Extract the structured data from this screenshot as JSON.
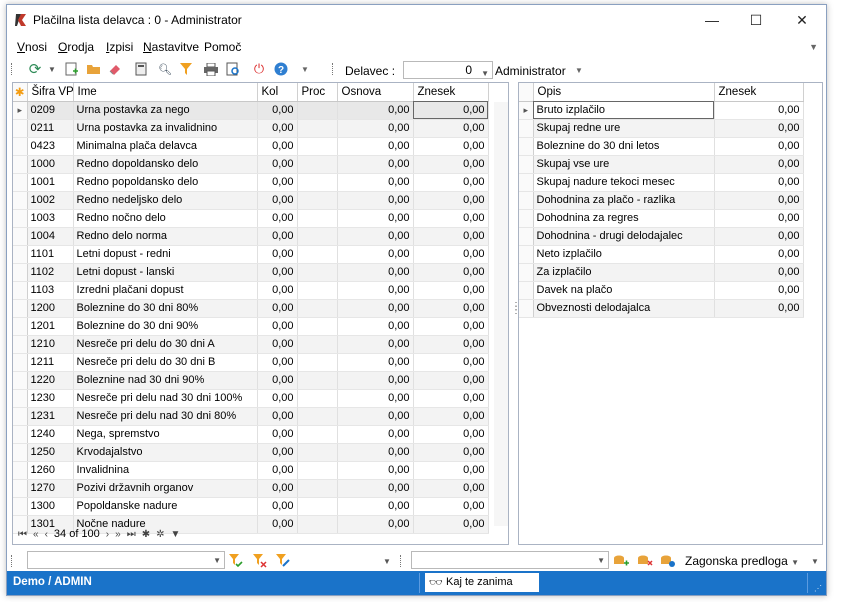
{
  "window": {
    "title": "Plačilna lista delavca : 0 -  Administrator",
    "minimize": "—",
    "maximize": "☐",
    "close": "✕"
  },
  "menu": {
    "items": [
      {
        "u": "V",
        "rest": "nosi"
      },
      {
        "u": "O",
        "rest": "rodja"
      },
      {
        "u": "I",
        "rest": "zpisi"
      },
      {
        "u": "N",
        "rest": "astavitve"
      },
      {
        "u": "",
        "rest": "Pomoč"
      }
    ]
  },
  "toolbar": {
    "delavec_label": "Delavec :",
    "delavec_value": "0",
    "user": "Administrator"
  },
  "left_grid": {
    "columns": [
      "Šifra VP",
      "Ime",
      "Kol",
      "Proc",
      "Osnova",
      "Znesek"
    ],
    "rows": [
      [
        "0209",
        "Urna postavka za nego",
        "0,00",
        "",
        "0,00",
        "0,00"
      ],
      [
        "0211",
        "Urna postavka za invalidnino",
        "0,00",
        "",
        "0,00",
        "0,00"
      ],
      [
        "0423",
        "Minimalna plača delavca",
        "0,00",
        "",
        "0,00",
        "0,00"
      ],
      [
        "1000",
        "Redno dopoldansko delo",
        "0,00",
        "",
        "0,00",
        "0,00"
      ],
      [
        "1001",
        "Redno popoldansko delo",
        "0,00",
        "",
        "0,00",
        "0,00"
      ],
      [
        "1002",
        "Redno nedeljsko delo",
        "0,00",
        "",
        "0,00",
        "0,00"
      ],
      [
        "1003",
        "Redno nočno delo",
        "0,00",
        "",
        "0,00",
        "0,00"
      ],
      [
        "1004",
        "Redno delo norma",
        "0,00",
        "",
        "0,00",
        "0,00"
      ],
      [
        "1101",
        "Letni dopust - redni",
        "0,00",
        "",
        "0,00",
        "0,00"
      ],
      [
        "1102",
        "Letni dopust - lanski",
        "0,00",
        "",
        "0,00",
        "0,00"
      ],
      [
        "1103",
        "Izredni plačani dopust",
        "0,00",
        "",
        "0,00",
        "0,00"
      ],
      [
        "1200",
        "Boleznine do 30 dni 80%",
        "0,00",
        "",
        "0,00",
        "0,00"
      ],
      [
        "1201",
        "Boleznine do 30 dni 90%",
        "0,00",
        "",
        "0,00",
        "0,00"
      ],
      [
        "1210",
        "Nesreče pri delu do 30 dni A",
        "0,00",
        "",
        "0,00",
        "0,00"
      ],
      [
        "1211",
        "Nesreče pri delu do 30 dni B",
        "0,00",
        "",
        "0,00",
        "0,00"
      ],
      [
        "1220",
        "Boleznine nad 30 dni 90%",
        "0,00",
        "",
        "0,00",
        "0,00"
      ],
      [
        "1230",
        "Nesreče pri delu nad 30 dni 100%",
        "0,00",
        "",
        "0,00",
        "0,00"
      ],
      [
        "1231",
        "Nesreče pri delu nad 30 dni 80%",
        "0,00",
        "",
        "0,00",
        "0,00"
      ],
      [
        "1240",
        "Nega, spremstvo",
        "0,00",
        "",
        "0,00",
        "0,00"
      ],
      [
        "1250",
        "Krvodajalstvo",
        "0,00",
        "",
        "0,00",
        "0,00"
      ],
      [
        "1260",
        "Invalidnina",
        "0,00",
        "",
        "0,00",
        "0,00"
      ],
      [
        "1270",
        "Pozivi državnih organov",
        "0,00",
        "",
        "0,00",
        "0,00"
      ],
      [
        "1300",
        "Popoldanske nadure",
        "0,00",
        "",
        "0,00",
        "0,00"
      ],
      [
        "1301",
        "Nočne nadure",
        "0,00",
        "",
        "0,00",
        "0,00"
      ]
    ],
    "record_info": "34 of 100"
  },
  "right_grid": {
    "columns": [
      "Opis",
      "Znesek"
    ],
    "rows": [
      [
        "Bruto izplačilo",
        "0,00"
      ],
      [
        "Skupaj redne ure",
        "0,00"
      ],
      [
        "Boleznine do 30 dni letos",
        "0,00"
      ],
      [
        "Skupaj vse ure",
        "0,00"
      ],
      [
        "Skupaj nadure tekoci mesec",
        "0,00"
      ],
      [
        "Dohodnina za plačo - razlika",
        "0,00"
      ],
      [
        "Dohodnina za regres",
        "0,00"
      ],
      [
        "Dohodnina - drugi delodajalec",
        "0,00"
      ],
      [
        "Neto izplačilo",
        "0,00"
      ],
      [
        "Za izplačilo",
        "0,00"
      ],
      [
        "Davek na plačo",
        "0,00"
      ],
      [
        "Obveznosti delodajalca",
        "0,00"
      ]
    ]
  },
  "filterbar": {
    "predloga": "Zagonska predloga"
  },
  "status": {
    "user": "Demo / ADMIN",
    "search_placeholder": "Kaj te zanima"
  }
}
